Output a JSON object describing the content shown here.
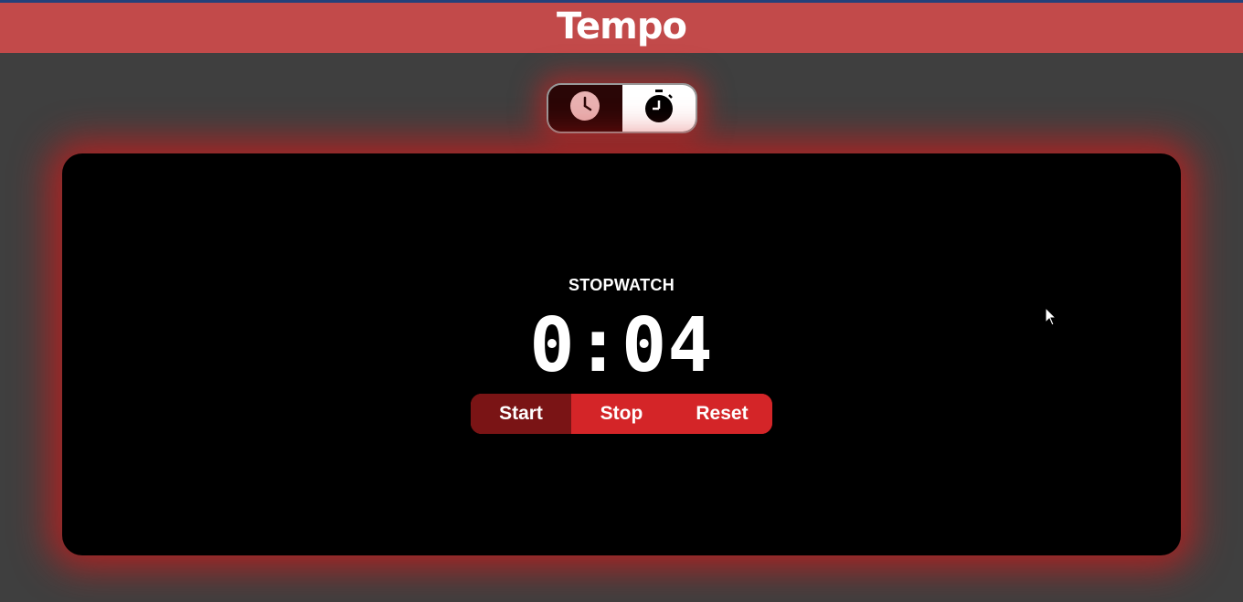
{
  "header": {
    "title": "Tempo",
    "accent_color": "#c24a4a"
  },
  "mode_toggle": {
    "options": [
      {
        "id": "clock",
        "icon": "clock-icon",
        "selected": false
      },
      {
        "id": "stopwatch",
        "icon": "stopwatch-icon",
        "selected": true
      }
    ]
  },
  "stopwatch": {
    "label": "STOPWATCH",
    "time": "0:04",
    "buttons": {
      "start": "Start",
      "stop": "Stop",
      "reset": "Reset"
    }
  },
  "colors": {
    "background": "#3f3f3f",
    "panel": "#000000",
    "glow": "#d21919",
    "button_red": "#d42528",
    "button_dark_red": "#7a1415"
  }
}
